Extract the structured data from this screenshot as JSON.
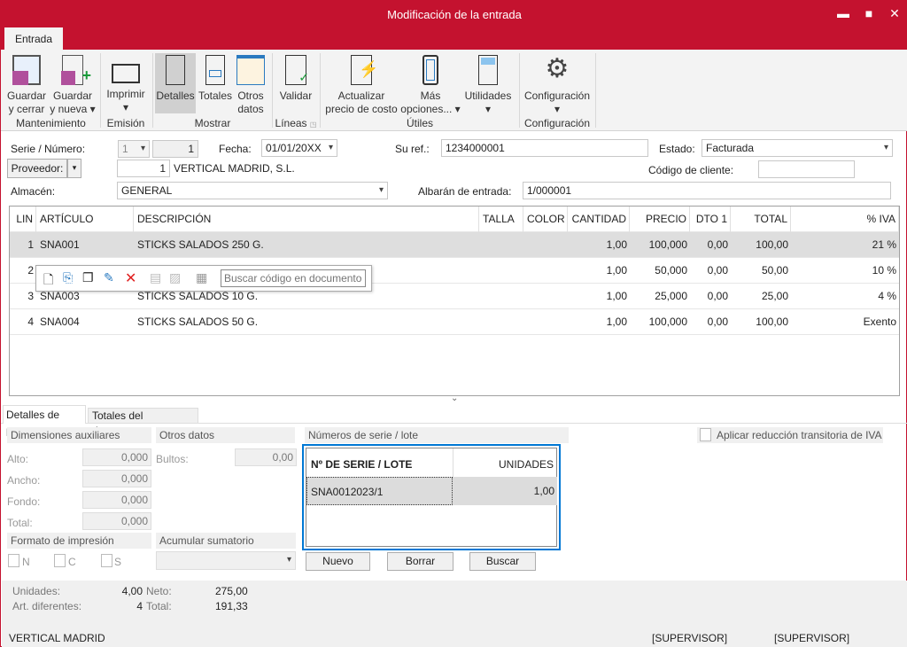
{
  "window": {
    "title": "Modificación de la entrada",
    "minimize": "▬",
    "maximize": "■",
    "close": "✕"
  },
  "ribbon": {
    "tab": "Entrada",
    "buttons": {
      "guardar_cerrar": [
        "Guardar",
        "y cerrar"
      ],
      "guardar_nueva": [
        "Guardar",
        "y nueva ▾"
      ],
      "imprimir": [
        "Imprimir",
        "▾"
      ],
      "detalles": [
        "Detalles"
      ],
      "totales": [
        "Totales"
      ],
      "otros_datos": [
        "Otros",
        "datos"
      ],
      "validar": [
        "Validar"
      ],
      "actualizar": [
        "Actualizar",
        "precio de costo"
      ],
      "mas_opciones": [
        "Más",
        "opciones... ▾"
      ],
      "utilidades": [
        "Utilidades",
        "▾"
      ],
      "configuracion": [
        "Configuración",
        "▾"
      ]
    },
    "groups": {
      "mantenimiento": "Mantenimiento",
      "emision": "Emisión",
      "mostrar": "Mostrar",
      "lineas": "Líneas",
      "utiles": "Útiles",
      "configuracion": "Configuración"
    }
  },
  "header": {
    "serie_label": "Serie / Número:",
    "serie": "1",
    "numero": "1",
    "fecha_label": "Fecha:",
    "fecha": "01/01/20XX",
    "suref_label": "Su ref.:",
    "suref": "1234000001",
    "estado_label": "Estado:",
    "estado": "Facturada",
    "proveedor_label": "Proveedor:",
    "proveedor_code": "1",
    "proveedor_name": "VERTICAL MADRID, S.L.",
    "codigo_cliente_label": "Código de cliente:",
    "codigo_cliente": "",
    "almacen_label": "Almacén:",
    "almacen": "GENERAL",
    "albaran_label": "Albarán de entrada:",
    "albaran": "1/000001"
  },
  "grid": {
    "columns": [
      "LIN",
      "ARTÍCULO",
      "DESCRIPCIÓN",
      "TALLA",
      "COLOR",
      "CANTIDAD",
      "PRECIO",
      "DTO 1",
      "TOTAL",
      "% IVA"
    ],
    "rows": [
      [
        "1",
        "SNA001",
        "STICKS SALADOS 250 G.",
        "",
        "",
        "1,00",
        "100,000",
        "0,00",
        "100,00",
        "21 %"
      ],
      [
        "2",
        "",
        "",
        "",
        "",
        "1,00",
        "50,000",
        "0,00",
        "50,00",
        "10 %"
      ],
      [
        "3",
        "SNA003",
        "STICKS SALADOS 10 G.",
        "",
        "",
        "1,00",
        "25,000",
        "0,00",
        "25,00",
        "4 %"
      ],
      [
        "4",
        "SNA004",
        "STICKS SALADOS 50 G.",
        "",
        "",
        "1,00",
        "100,000",
        "0,00",
        "100,00",
        "Exento"
      ]
    ],
    "search_placeholder": "Buscar código en documento"
  },
  "bottom_tabs": [
    "Detalles de línea",
    "Totales del documento"
  ],
  "details": {
    "dim_title": "Dimensiones auxiliares",
    "alto_label": "Alto:",
    "alto": "0,000",
    "ancho_label": "Ancho:",
    "ancho": "0,000",
    "fondo_label": "Fondo:",
    "fondo": "0,000",
    "total_label": "Total:",
    "total": "0,000",
    "otros_title": "Otros datos",
    "bultos_label": "Bultos:",
    "bultos": "0,00",
    "formato_title": "Formato de impresión",
    "formato_opts": [
      "N",
      "C",
      "S"
    ],
    "acumular_title": "Acumular sumatorio",
    "serie_title": "Números de serie / lote",
    "serie_cols": [
      "Nº DE SERIE / LOTE",
      "UNIDADES"
    ],
    "serie_rows": [
      [
        "SNA0012023/1",
        "1,00"
      ]
    ],
    "nuevo": "Nuevo",
    "borrar": "Borrar",
    "buscar": "Buscar",
    "iva_reduccion": "Aplicar reducción transitoria de IVA"
  },
  "summary": {
    "unidades_label": "Unidades:",
    "unidades": "4,00",
    "art_label": "Art. diferentes:",
    "art": "4",
    "neto_label": "Neto:",
    "neto": "275,00",
    "total_label": "Total:",
    "total": "191,33"
  },
  "status": {
    "company": "VERTICAL MADRID",
    "user1": "[SUPERVISOR]",
    "user2": "[SUPERVISOR]"
  },
  "colors": {
    "accent": "#c4122f",
    "selection": "#0078d4"
  }
}
